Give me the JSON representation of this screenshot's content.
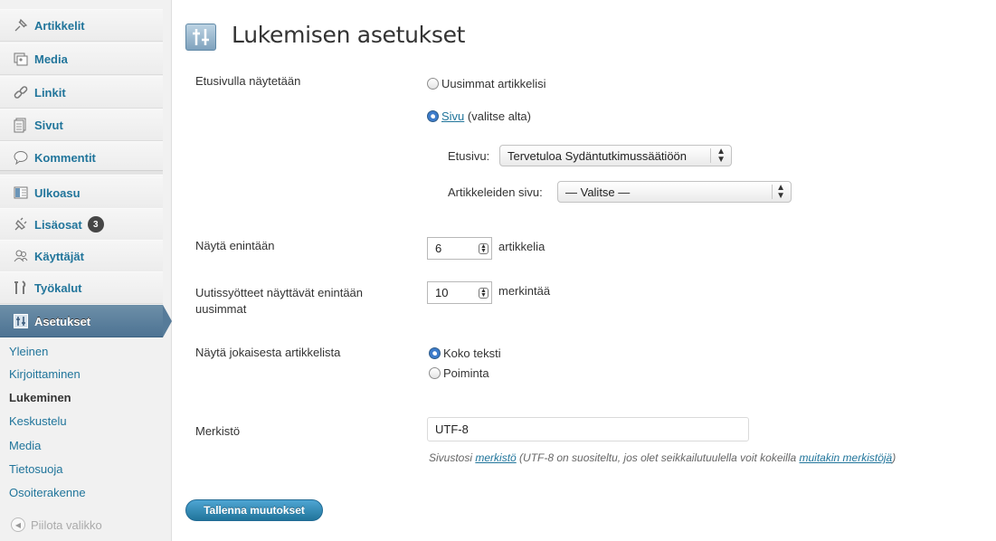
{
  "sidebar": {
    "items": [
      {
        "label": "Artikkelit",
        "icon": "pin-icon"
      },
      {
        "label": "Media",
        "icon": "media-icon"
      },
      {
        "label": "Linkit",
        "icon": "link-icon"
      },
      {
        "label": "Sivut",
        "icon": "pages-icon"
      },
      {
        "label": "Kommentit",
        "icon": "comment-icon"
      },
      {
        "label": "Ulkoasu",
        "icon": "appearance-icon"
      },
      {
        "label": "Lisäosat",
        "icon": "plugin-icon",
        "badge": "3"
      },
      {
        "label": "Käyttäjät",
        "icon": "users-icon"
      },
      {
        "label": "Työkalut",
        "icon": "tools-icon"
      },
      {
        "label": "Asetukset",
        "icon": "settings-icon"
      }
    ],
    "submenu": [
      "Yleinen",
      "Kirjoittaminen",
      "Lukeminen",
      "Keskustelu",
      "Media",
      "Tietosuoja",
      "Osoiterakenne"
    ],
    "collapse_label": "Piilota valikko"
  },
  "page": {
    "title": "Lukemisen asetukset"
  },
  "front_page": {
    "label": "Etusivulla näytetään",
    "option_latest": "Uusimmat artikkelisi",
    "option_page_link": "Sivu",
    "option_page_suffix": " (valitse alta)",
    "frontpage_label": "Etusivu:",
    "frontpage_value": "Tervetuloa Sydäntutkimussäätiöön",
    "postspage_label": "Artikkeleiden sivu:",
    "postspage_value": "— Valitse —"
  },
  "posts_per_page": {
    "label": "Näytä enintään",
    "value": "6",
    "suffix": "artikkelia"
  },
  "feed_items": {
    "label_line1": "Uutissyötteet näyttävät enintään",
    "label_line2": "uusimmat",
    "value": "10",
    "suffix": "merkintää"
  },
  "feed_display": {
    "label": "Näytä jokaisesta artikkelista",
    "option_full": "Koko teksti",
    "option_summary": "Poiminta"
  },
  "charset": {
    "label": "Merkistö",
    "value": "UTF-8",
    "desc_pre": "Sivustosi ",
    "desc_link1": "merkistö",
    "desc_mid": " (UTF-8 on suositeltu, jos olet seikkailutuulella voit kokeilla ",
    "desc_link2": "muitakin merkistöjä",
    "desc_post": ")"
  },
  "save_label": "Tallenna muutokset",
  "colors": {
    "link": "#21759b",
    "active_menu": "#4d7393",
    "button": "#21759b"
  }
}
